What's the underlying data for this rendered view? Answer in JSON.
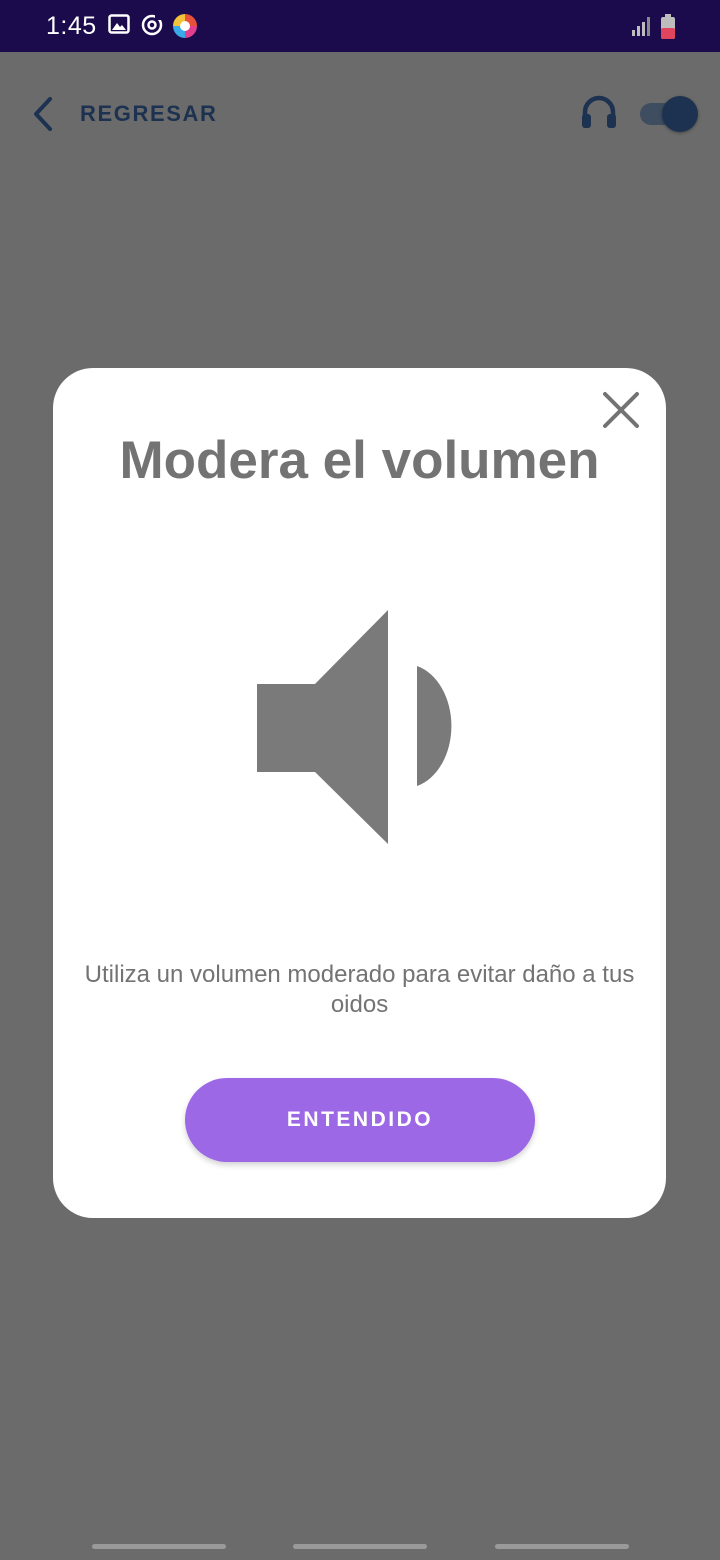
{
  "status_bar": {
    "time": "1:45",
    "icons": [
      "gallery-icon",
      "sync-icon",
      "app-notification-icon",
      "signal-icon",
      "battery-icon"
    ]
  },
  "header": {
    "back_label": "REGRESAR",
    "headphones_icon": "headphones-icon",
    "toggle_on": true
  },
  "dialog": {
    "title": "Modera el volumen",
    "message": "Utiliza un volumen moderado para evitar daño a tus oidos",
    "button_label": "ENTENDIDO",
    "icon": "speaker-volume-icon"
  },
  "colors": {
    "status_bar": "#1b0b4d",
    "scrim": "#6b6b6b",
    "header_accent": "#1c3250",
    "button": "#9d68e6",
    "dialog_text": "#737373"
  }
}
